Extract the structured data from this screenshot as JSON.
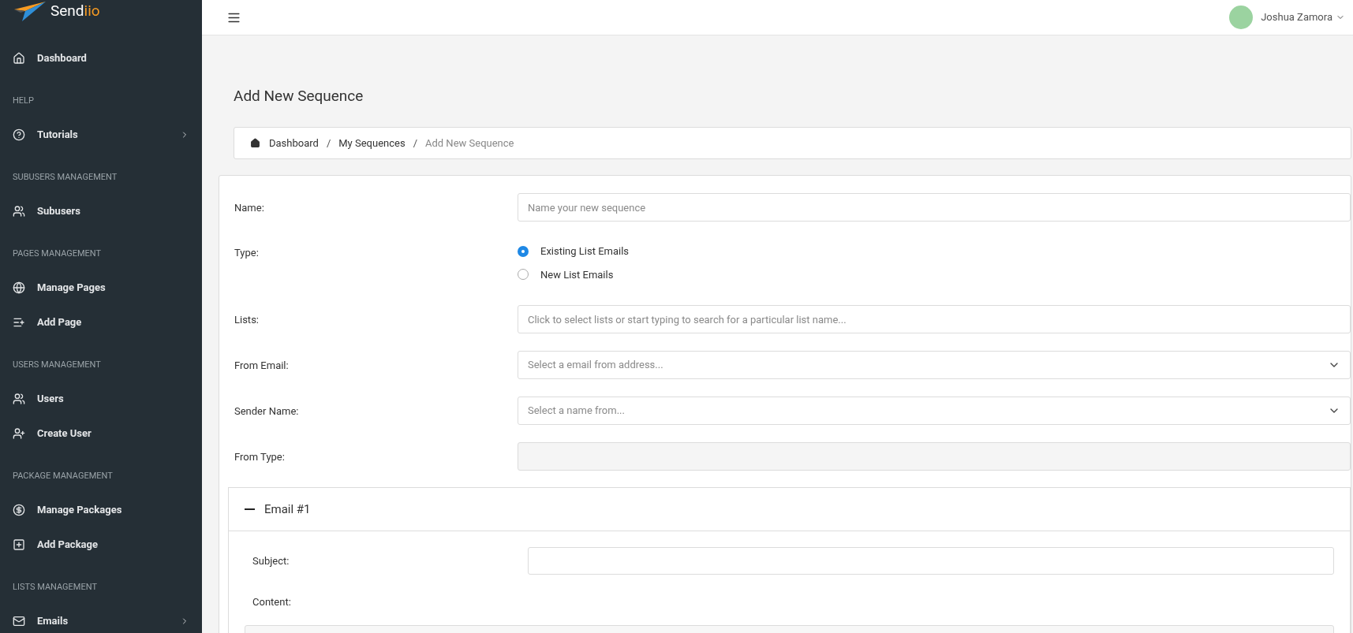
{
  "logo": {
    "text": "Send",
    "accent": "iio"
  },
  "sidebar": {
    "items": [
      {
        "kind": "link",
        "label": "Dashboard",
        "expandable": false
      },
      {
        "kind": "section",
        "label": "HELP"
      },
      {
        "kind": "link",
        "label": "Tutorials",
        "expandable": true
      },
      {
        "kind": "section",
        "label": "SUBUSERS MANAGEMENT"
      },
      {
        "kind": "link",
        "label": "Subusers",
        "expandable": false
      },
      {
        "kind": "section",
        "label": "PAGES MANAGEMENT"
      },
      {
        "kind": "link",
        "label": "Manage Pages",
        "expandable": false
      },
      {
        "kind": "link",
        "label": "Add Page",
        "expandable": false
      },
      {
        "kind": "section",
        "label": "USERS MANAGEMENT"
      },
      {
        "kind": "link",
        "label": "Users",
        "expandable": false
      },
      {
        "kind": "link",
        "label": "Create User",
        "expandable": false
      },
      {
        "kind": "section",
        "label": "PACKAGE MANAGEMENT"
      },
      {
        "kind": "link",
        "label": "Manage Packages",
        "expandable": false
      },
      {
        "kind": "link",
        "label": "Add Package",
        "expandable": false
      },
      {
        "kind": "section",
        "label": "LISTS MANAGEMENT"
      },
      {
        "kind": "link",
        "label": "Emails",
        "expandable": true
      }
    ]
  },
  "topbar": {
    "user": "Joshua Zamora"
  },
  "page_title": "Add New Sequence",
  "breadcrumb": [
    {
      "label": "Dashboard",
      "current": false
    },
    {
      "separator": "/",
      "label": "My Sequences",
      "current": false
    },
    {
      "separator": "/",
      "label": "Add New Sequence",
      "current": true
    }
  ],
  "form": {
    "fields": [
      {
        "kind": "text",
        "label": "Name:",
        "placeholder": "Name your new sequence"
      },
      {
        "kind": "radio",
        "label": "Type:",
        "options": [
          {
            "label": "Existing List Emails",
            "selected": true
          },
          {
            "label": "New List Emails",
            "selected": false
          }
        ]
      },
      {
        "kind": "text",
        "label": "Lists:",
        "placeholder": "Click to select lists or start typing to search for a particular list name..."
      },
      {
        "kind": "select",
        "label": "From Email:",
        "placeholder": "Select a email from address..."
      },
      {
        "kind": "select",
        "label": "Sender Name:",
        "placeholder": "Select a name from..."
      },
      {
        "kind": "disabled",
        "label": "From Type:"
      }
    ]
  },
  "email_panel": {
    "title": "Email #1",
    "expanded": true,
    "subject_label": "Subject:",
    "content_label": "Content:"
  }
}
